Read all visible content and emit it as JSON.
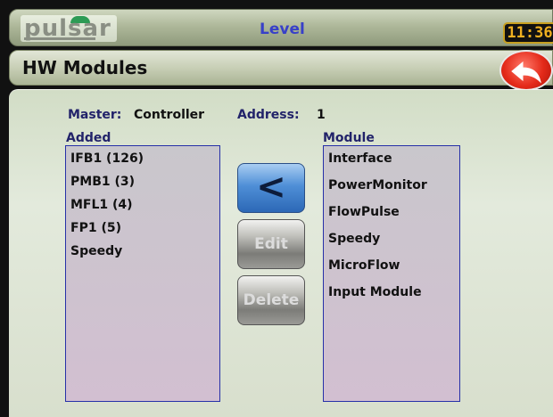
{
  "topbar": {
    "logo_text": "pulsar",
    "title": "Level",
    "clock": "11:36"
  },
  "header": {
    "title": "HW Modules",
    "back_icon": "undo-arrow-icon"
  },
  "info": {
    "master_label": "Master:",
    "master_value": "Controller",
    "address_label": "Address:",
    "address_value": "1"
  },
  "added": {
    "label": "Added",
    "items": [
      "IFB1 (126)",
      "PMB1 (3)",
      "MFL1 (4)",
      "FP1 (5)",
      "Speedy"
    ]
  },
  "module": {
    "label": "Module",
    "items": [
      "Interface",
      "PowerMonitor",
      "FlowPulse",
      "Speedy",
      "MicroFlow",
      "Input Module"
    ]
  },
  "buttons": {
    "add_label": "<",
    "edit_label": "Edit",
    "delete_label": "Delete"
  },
  "colors": {
    "title_blue": "#3840c8",
    "label_blue": "#22236a",
    "list_border": "#2630a8",
    "clock_amber": "#f0b020",
    "back_red": "#e42a1a"
  }
}
